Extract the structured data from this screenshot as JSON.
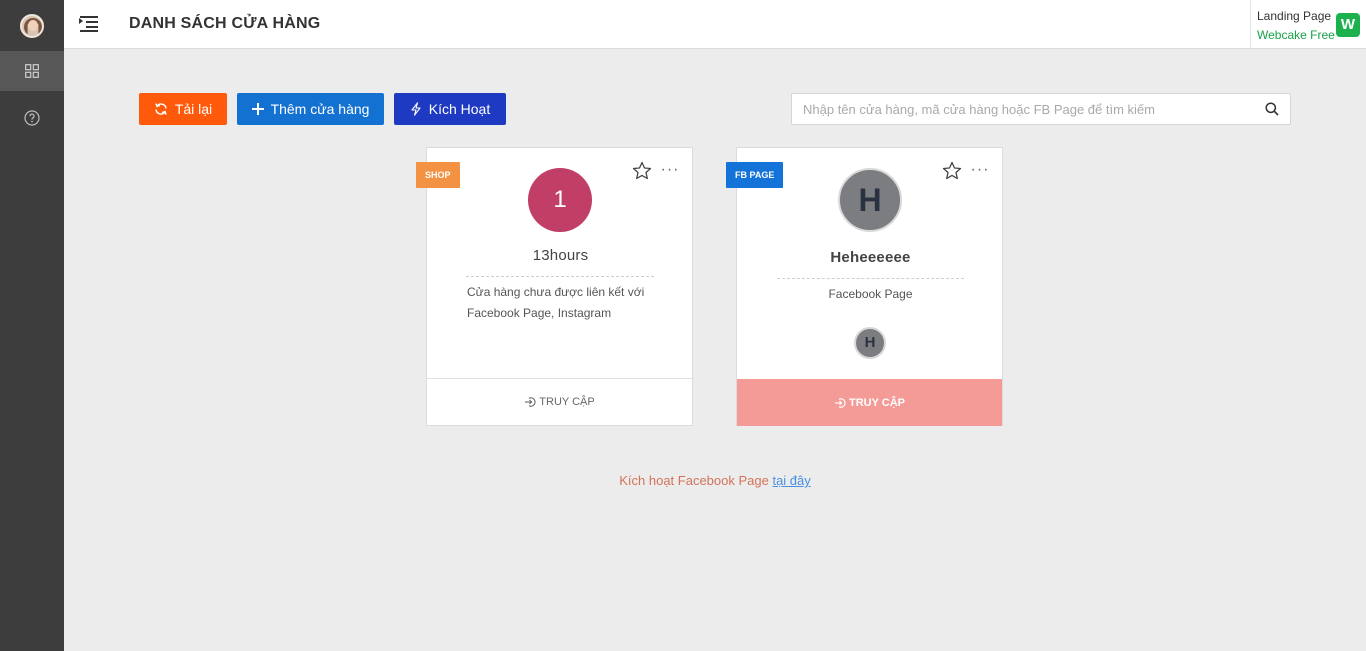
{
  "header": {
    "title": "DANH SÁCH CỬA HÀNG",
    "brand_line1": "Landing Page",
    "brand_line2": "Webcake Free",
    "brand_logo_letter": "W"
  },
  "sidebar": {
    "items": [
      {
        "name": "user-avatar"
      },
      {
        "icon": "grid-icon",
        "active": true
      },
      {
        "icon": "help-icon"
      }
    ]
  },
  "toolbar": {
    "reload_label": "Tải lại",
    "add_label": "Thêm cửa hàng",
    "activate_label": "Kích Hoạt"
  },
  "search": {
    "placeholder": "Nhập tên cửa hàng, mã cửa hàng hoặc FB Page để tìm kiếm"
  },
  "cards": [
    {
      "tag": "SHOP",
      "avatar_text": "1",
      "name": "13hours",
      "desc_line1": "Cửa hàng chưa được liên kết với",
      "desc_line2": "Facebook Page, Instagram",
      "access_label": "TRUY CẬP"
    },
    {
      "tag": "FB PAGE",
      "avatar_text": "H",
      "name": "Heheeeeee",
      "desc": "Facebook Page",
      "small_avatar_text": "H",
      "access_label": "TRUY CẬP"
    }
  ],
  "footnote": {
    "text": "Kích hoạt Facebook Page ",
    "link": "tại đây"
  },
  "colors": {
    "reload": "#ff5a0b",
    "add": "#1371d2",
    "activate": "#1e3ac2",
    "shop_tag": "#f39242",
    "fb_tag": "#1373d8",
    "access_active": "#f49b97"
  }
}
